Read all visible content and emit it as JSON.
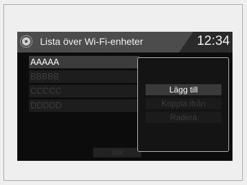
{
  "header": {
    "title": "Lista över Wi-Fi-enheter",
    "clock": "12:34"
  },
  "device_list": {
    "items": [
      {
        "label": "AAAAA",
        "state": "selected"
      },
      {
        "label": "BBBBB",
        "state": "dim"
      },
      {
        "label": "CCCCC",
        "state": "dim"
      },
      {
        "label": "DDDDD",
        "state": "dim"
      }
    ]
  },
  "bottom_tab": {
    "label": "Sök"
  },
  "popup_menu": {
    "items": [
      {
        "label": "Lägg till",
        "state": "active"
      },
      {
        "label": "Koppla ifrån",
        "state": "dim"
      },
      {
        "label": "Radera",
        "state": "dim"
      }
    ]
  },
  "colors": {
    "screen_background": "#0c0c0c",
    "header_tab": "#4c4c4c",
    "popup_border": "#b5b5b5",
    "text_active": "#ffffff",
    "text_dim": "#3d3d3d"
  },
  "icons": {
    "header": "gear-icon"
  }
}
